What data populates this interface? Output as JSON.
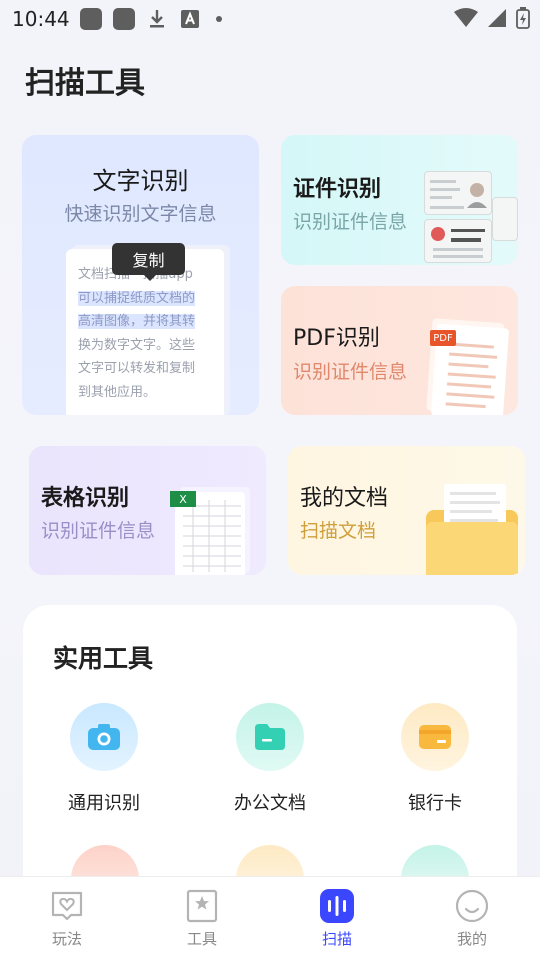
{
  "status": {
    "time": "10:44"
  },
  "page_title": "扫描工具",
  "cards": {
    "text_recognition": {
      "title": "文字识别",
      "subtitle": "快速识别文字信息",
      "sample_lines": [
        "文档扫描 · 扫描app",
        "可以捕捉纸质文档的",
        "高清图像，并将其转",
        "换为数字文字。这些",
        "文字可以转发和复制",
        "到其他应用。"
      ],
      "copy_popup": "复制"
    },
    "id_recognition": {
      "title": "证件识别",
      "subtitle": "识别证件信息"
    },
    "pdf_recognition": {
      "title": "PDF识别",
      "subtitle": "识别证件信息",
      "badge": "PDF"
    },
    "table_recognition": {
      "title": "表格识别",
      "subtitle": "识别证件信息",
      "badge": "X"
    },
    "my_docs": {
      "title": "我的文档",
      "subtitle": "扫描文档"
    }
  },
  "tools": {
    "title": "实用工具",
    "items": [
      {
        "label": "通用识别",
        "icon": "camera-icon",
        "color": "#43b6f0"
      },
      {
        "label": "办公文档",
        "icon": "folder-icon",
        "color": "#33d0b4"
      },
      {
        "label": "银行卡",
        "icon": "card-icon",
        "color": "#f8b93e"
      }
    ]
  },
  "nav": {
    "items": [
      {
        "label": "玩法",
        "icon": "heart-chat-icon"
      },
      {
        "label": "工具",
        "icon": "bookmark-star-icon"
      },
      {
        "label": "扫描",
        "icon": "scan-icon"
      },
      {
        "label": "我的",
        "icon": "smile-icon"
      }
    ],
    "active": "扫描",
    "active_color": "#3b46ff"
  }
}
